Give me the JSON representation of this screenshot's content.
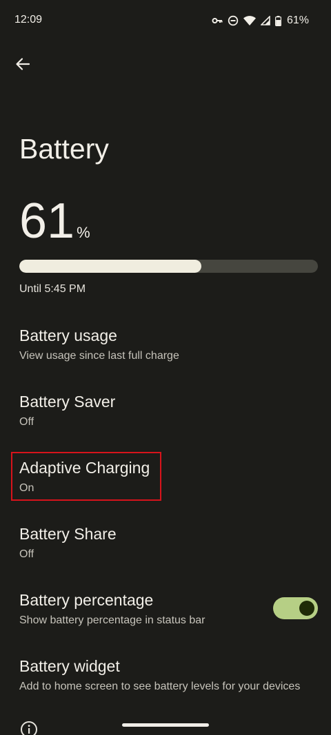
{
  "status_bar": {
    "time": "12:09",
    "battery_percent": "61%",
    "icons": [
      "vpn-key-icon",
      "do-not-disturb-icon",
      "wifi-icon",
      "cell-signal-icon",
      "battery-icon"
    ]
  },
  "header": {
    "back_icon": "arrow-back-icon",
    "title": "Battery"
  },
  "battery": {
    "value": "61",
    "unit": "%",
    "level_fraction": 0.61,
    "until": "Until 5:45 PM"
  },
  "settings": [
    {
      "title": "Battery usage",
      "subtitle": "View usage since last full charge"
    },
    {
      "title": "Battery Saver",
      "subtitle": "Off"
    },
    {
      "title": "Adaptive Charging",
      "subtitle": "On"
    },
    {
      "title": "Battery Share",
      "subtitle": "Off"
    },
    {
      "title": "Battery percentage",
      "subtitle": "Show battery percentage in status bar",
      "toggle_on": true
    },
    {
      "title": "Battery widget",
      "subtitle": "Add to home screen to see battery levels for your devices"
    }
  ],
  "colors": {
    "background": "#1c1c19",
    "bar_fill": "#f0eddf",
    "bar_track": "#46463f",
    "toggle_track": "#b6cf85",
    "toggle_knob": "#1f2b07",
    "highlight": "#d8131b"
  },
  "footer": {
    "info_icon": "info-icon"
  }
}
